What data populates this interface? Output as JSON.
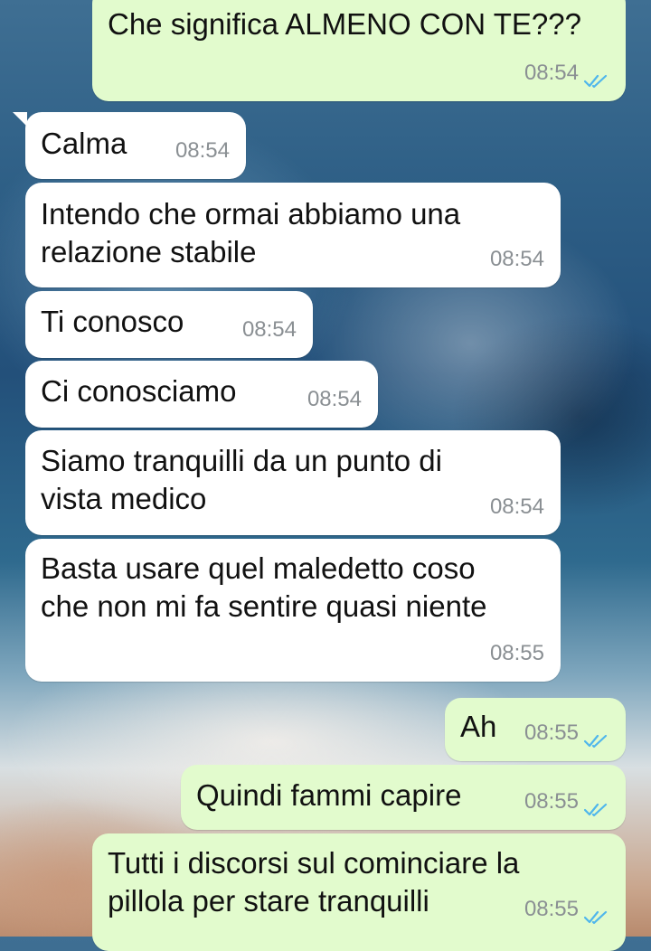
{
  "messages": [
    {
      "id": "m1",
      "dir": "out",
      "lines": [
        "Che significa ALMENO CON TE???"
      ],
      "time": "08:54",
      "ticks": "read"
    },
    {
      "id": "m2",
      "dir": "in",
      "lines": [
        "Calma"
      ],
      "time": "08:54"
    },
    {
      "id": "m3",
      "dir": "in",
      "lines": [
        "Intendo che ormai abbiamo una",
        "relazione stabile"
      ],
      "time": "08:54"
    },
    {
      "id": "m4",
      "dir": "in",
      "lines": [
        "Ti conosco"
      ],
      "time": "08:54"
    },
    {
      "id": "m5",
      "dir": "in",
      "lines": [
        "Ci conosciamo"
      ],
      "time": "08:54"
    },
    {
      "id": "m6",
      "dir": "in",
      "lines": [
        "Siamo tranquilli da un punto di",
        "vista medico"
      ],
      "time": "08:54"
    },
    {
      "id": "m7",
      "dir": "in",
      "lines": [
        "Basta usare quel maledetto coso",
        "che non mi fa sentire quasi niente"
      ],
      "time": "08:55"
    },
    {
      "id": "m8",
      "dir": "out",
      "lines": [
        "Ah"
      ],
      "time": "08:55",
      "ticks": "read"
    },
    {
      "id": "m9",
      "dir": "out",
      "lines": [
        "Quindi fammi capire"
      ],
      "time": "08:55",
      "ticks": "read"
    },
    {
      "id": "m10",
      "dir": "out",
      "lines": [
        "Tutti i discorsi sul cominciare la",
        "pillola per stare tranquilli"
      ],
      "time": "08:55",
      "ticks": "read"
    }
  ],
  "colors": {
    "incoming": "#ffffff",
    "outgoing": "#e2fbcd",
    "tick_read": "#4fb6ec",
    "time": "#8a8f93"
  }
}
